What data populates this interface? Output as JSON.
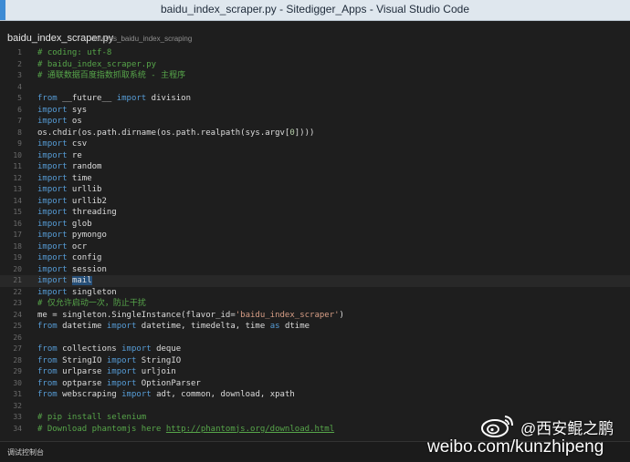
{
  "window": {
    "title": "baidu_index_scraper.py - Sitedigger_Apps - Visual Studio Code"
  },
  "tab": {
    "filename": "baidu_index_scraper.py",
    "path": "datayes_baidu_index_scraping"
  },
  "editor": {
    "lines": [
      {
        "n": "1",
        "code": "# coding: utf-8"
      },
      {
        "n": "2",
        "code": "# baidu_index_scraper.py"
      },
      {
        "n": "3",
        "code": "# 通联数据百度指数抓取系统 - 主程序"
      },
      {
        "n": "4",
        "code": ""
      },
      {
        "n": "5",
        "code": "from __future__ import division"
      },
      {
        "n": "6",
        "code": "import sys"
      },
      {
        "n": "7",
        "code": "import os"
      },
      {
        "n": "8",
        "code": "os.chdir(os.path.dirname(os.path.realpath(sys.argv[0])))"
      },
      {
        "n": "9",
        "code": "import csv"
      },
      {
        "n": "10",
        "code": "import re"
      },
      {
        "n": "11",
        "code": "import random"
      },
      {
        "n": "12",
        "code": "import time"
      },
      {
        "n": "13",
        "code": "import urllib"
      },
      {
        "n": "14",
        "code": "import urllib2"
      },
      {
        "n": "15",
        "code": "import threading"
      },
      {
        "n": "16",
        "code": "import glob"
      },
      {
        "n": "17",
        "code": "import pymongo"
      },
      {
        "n": "18",
        "code": "import ocr"
      },
      {
        "n": "19",
        "code": "import config"
      },
      {
        "n": "20",
        "code": "import session"
      },
      {
        "n": "21",
        "code": "import mail"
      },
      {
        "n": "22",
        "code": "import singleton"
      },
      {
        "n": "23",
        "code": "# 仅允许启动一次，防止干扰"
      },
      {
        "n": "24",
        "code": "me = singleton.SingleInstance(flavor_id='baidu_index_scraper')"
      },
      {
        "n": "25",
        "code": "from datetime import datetime, timedelta, time as dtime"
      },
      {
        "n": "26",
        "code": ""
      },
      {
        "n": "27",
        "code": "from collections import deque"
      },
      {
        "n": "28",
        "code": "from StringIO import StringIO"
      },
      {
        "n": "29",
        "code": "from urlparse import urljoin"
      },
      {
        "n": "30",
        "code": "from optparse import OptionParser"
      },
      {
        "n": "31",
        "code": "from webscraping import adt, common, download, xpath"
      },
      {
        "n": "32",
        "code": ""
      },
      {
        "n": "33",
        "code": "# pip install selenium"
      },
      {
        "n": "34",
        "code": "# Download phantomjs here http://phantomjs.org/download.html"
      }
    ]
  },
  "status": {
    "text": "调试控制台"
  },
  "watermark": {
    "handle": "@西安鲲之鹏",
    "url": "weibo.com/kunzhipeng"
  }
}
